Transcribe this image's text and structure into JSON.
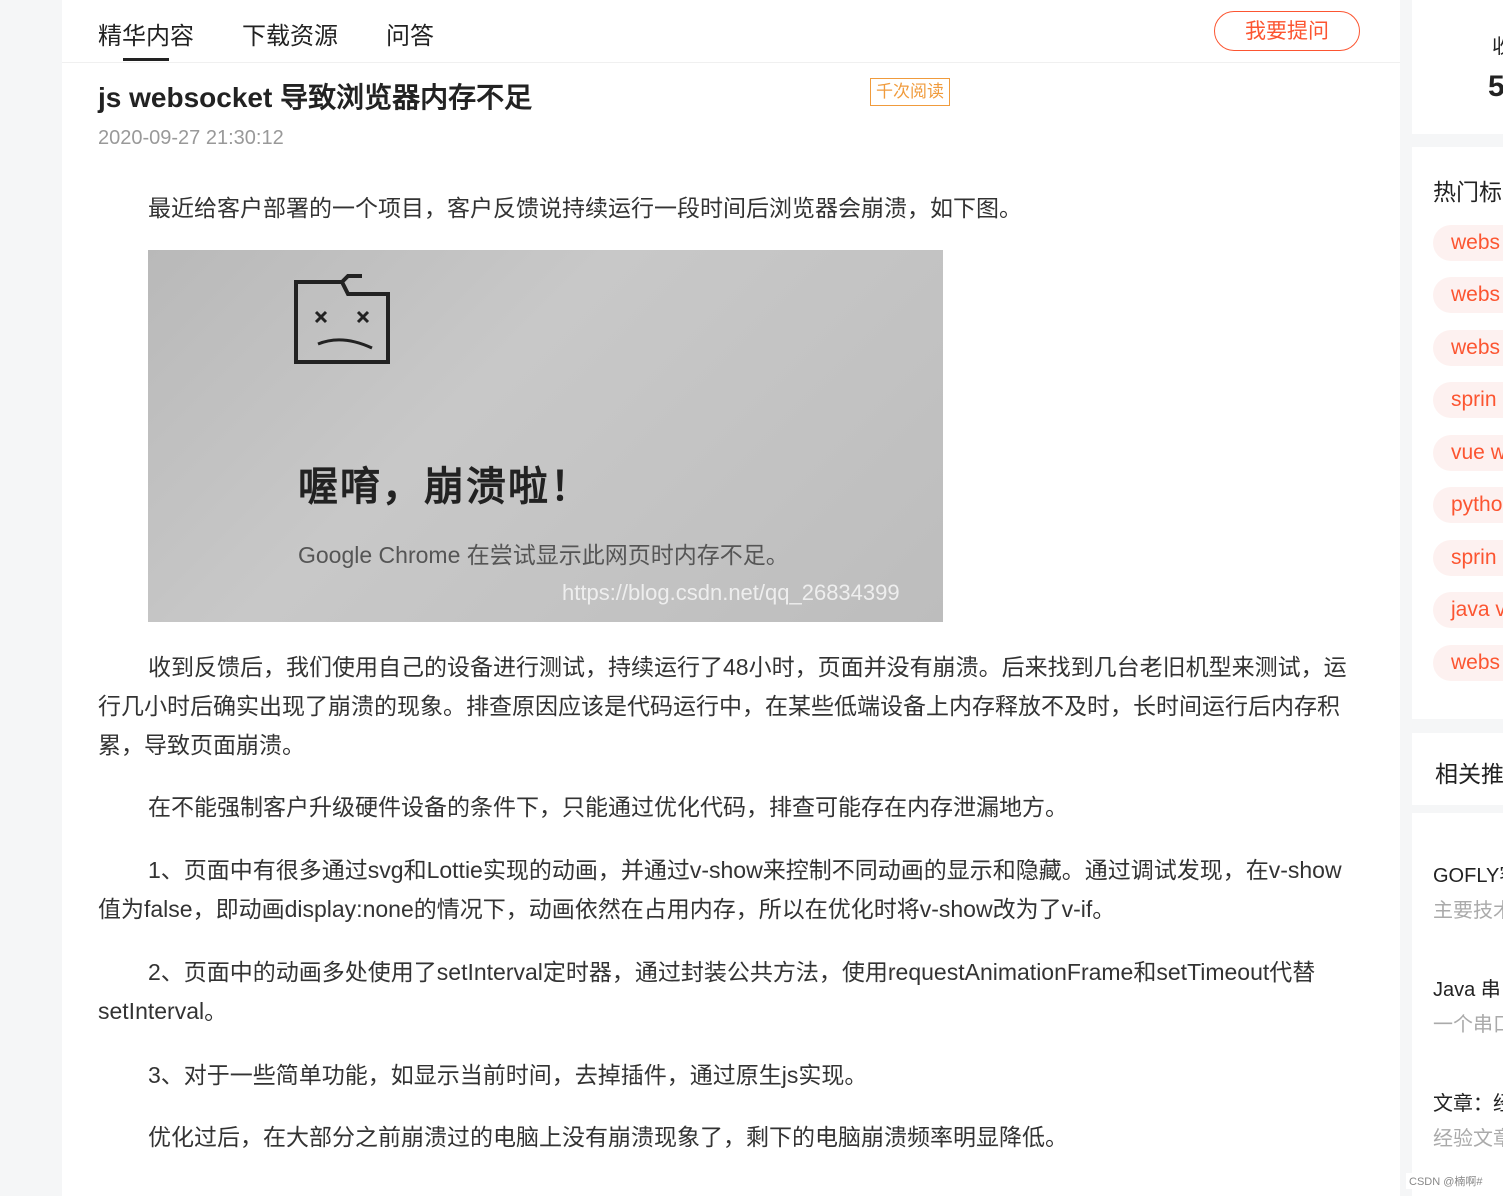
{
  "tabs": [
    {
      "label": "精华内容"
    },
    {
      "label": "下载资源"
    },
    {
      "label": "问答"
    }
  ],
  "ask_button": "我要提问",
  "article": {
    "title": "js websocket 导致浏览器内存不足",
    "badge": "千次阅读",
    "date": "2020-09-27 21:30:12",
    "paragraphs": [
      "最近给客户部署的一个项目，客户反馈说持续运行一段时间后浏览器会崩溃，如下图。",
      "收到反馈后，我们使用自己的设备进行测试，持续运行了48小时，页面并没有崩溃。后来找到几台老旧机型来测试，运行几小时后确实出现了崩溃的现象。排查原因应该是代码运行中，在某些低端设备上内存释放不及时，长时间运行后内存积累，导致页面崩溃。",
      "在不能强制客户升级硬件设备的条件下，只能通过优化代码，排查可能存在内存泄漏地方。",
      "1、页面中有很多通过svg和Lottie实现的动画，并通过v-show来控制不同动画的显示和隐藏。通过调试发现，在v-show值为false，即动画display:none的情况下，动画依然在占用内存，所以在优化时将v-show改为了v-if。",
      "2、页面中的动画多处使用了setInterval定时器，通过封装公共方法，使用requestAnimationFrame和setTimeout代替setInterval。",
      "3、对于一些简单功能，如显示当前时间，去掉插件，通过原生js实现。",
      "优化过后，在大部分之前崩溃过的电脑上没有崩溃现象了，剩下的电脑崩溃频率明显降低。"
    ],
    "figure": {
      "headline": "喔唷，崩溃啦！",
      "subtext": "Google Chrome 在尝试显示此网页时内存不足。",
      "watermark": "https://blog.csdn.net/qq_26834399"
    }
  },
  "sidebar": {
    "stat_label": "收",
    "stat_value": "5",
    "hot_tags_title": "热门标",
    "hot_tags": [
      "webs",
      "webs",
      "webs",
      "sprin",
      "vue w",
      "pytho",
      "sprin",
      "java v",
      "webs"
    ],
    "related_title": "相关推",
    "related": [
      {
        "title": "GOFLY客",
        "desc": "主要技术"
      },
      {
        "title": "Java 串",
        "desc": "一个串口"
      },
      {
        "title": "文章：经",
        "desc": "经验文章"
      }
    ]
  },
  "footer_mark": "CSDN @楠啊#"
}
